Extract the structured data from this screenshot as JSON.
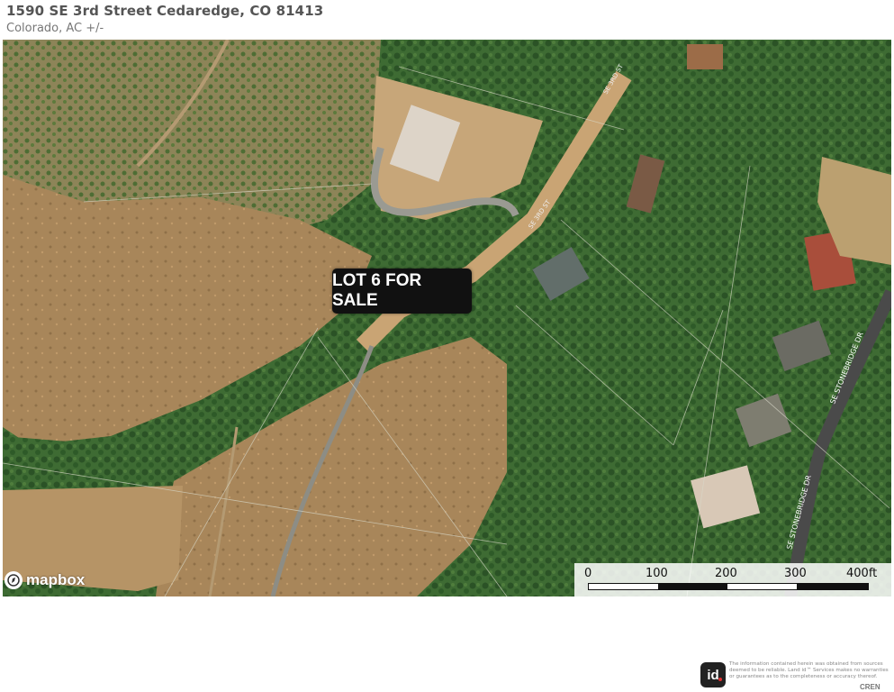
{
  "header": {
    "title": "1590 SE 3rd Street Cedaredge, CO  81413",
    "subtitle": "Colorado,  AC +/-"
  },
  "map": {
    "lot_label": "LOT 6 FOR SALE",
    "provider_logo": "mapbox",
    "streets": [
      "SE 3RD ST",
      "SE 3RD ST",
      "SE STONEBRIDGE DR",
      "SE STONEBRIDGE DR"
    ],
    "scale_bar": {
      "labels": [
        "0",
        "100",
        "200",
        "300",
        "400ft"
      ]
    },
    "colors": {
      "vegetation": "#3c6a34",
      "dry_ground": "#b89060",
      "road": "#4a4a4a"
    }
  },
  "footer": {
    "logo_text": "id",
    "disclaimer": "The information contained herein was obtained from sources deemed to be reliable. Land id™ Services makes no warranties or guarantees as to the completeness or accuracy thereof.",
    "cren": "CREN"
  }
}
